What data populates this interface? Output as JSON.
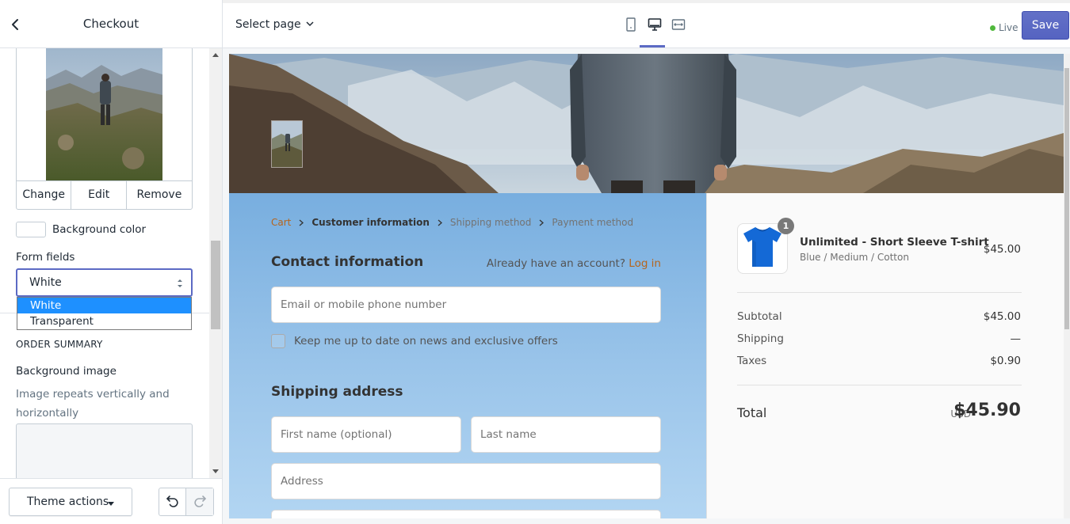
{
  "sidebar": {
    "title": "Checkout",
    "image_actions": {
      "change": "Change",
      "edit": "Edit",
      "remove": "Remove"
    },
    "background_color_label": "Background color",
    "form_fields_label": "Form fields",
    "form_fields_select": {
      "value": "White",
      "options": [
        "White",
        "Transparent"
      ]
    },
    "order_summary_heading": "ORDER SUMMARY",
    "background_image_label": "Background image",
    "background_image_help": "Image repeats vertically and horizontally",
    "theme_actions_label": "Theme actions"
  },
  "topbar": {
    "select_page_label": "Select page",
    "live_label": "Live",
    "save_label": "Save",
    "colors": {
      "accent": "#5c6ac4",
      "live": "#50b83c"
    }
  },
  "checkout": {
    "breadcrumbs": [
      "Cart",
      "Customer information",
      "Shipping method",
      "Payment method"
    ],
    "contact_heading": "Contact information",
    "have_account_text": "Already have an account?",
    "login_link": "Log in",
    "email_placeholder": "Email or mobile phone number",
    "newsletter_label": "Keep me up to date on news and exclusive offers",
    "shipping_heading": "Shipping address",
    "first_name_placeholder": "First name (optional)",
    "last_name_placeholder": "Last name",
    "address_placeholder": "Address",
    "colors": {
      "link": "#b5651d"
    }
  },
  "order_summary": {
    "product": {
      "name": "Unlimited - Short Sleeve T-shirt",
      "variant": "Blue / Medium / Cotton",
      "price": "$45.00",
      "quantity": "1"
    },
    "subtotal_label": "Subtotal",
    "subtotal_value": "$45.00",
    "shipping_label": "Shipping",
    "shipping_value": "—",
    "taxes_label": "Taxes",
    "taxes_value": "$0.90",
    "total_label": "Total",
    "currency": "USD",
    "total_value": "$45.90"
  },
  "icons": [
    "chevron-left-icon",
    "select-caret-icon",
    "chevron-down-icon",
    "mobile-icon",
    "desktop-icon",
    "fullscreen-icon",
    "undo-icon",
    "redo-icon",
    "breadcrumb-chevron-icon",
    "tshirt-icon"
  ]
}
